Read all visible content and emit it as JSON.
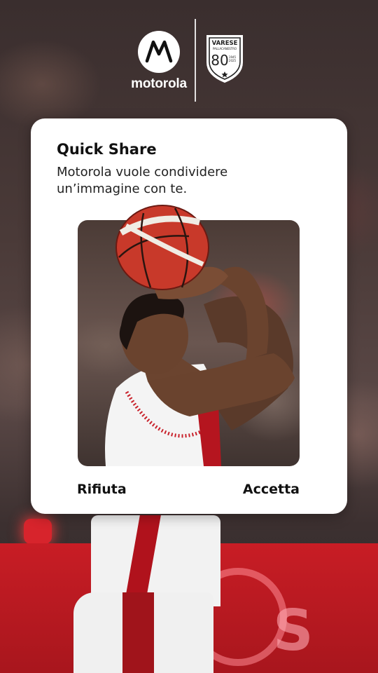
{
  "brand": {
    "motorola_word": "motorola",
    "varese_crest_text": "VARESE",
    "varese_crest_sub": "PALLACANESTRO",
    "varese_crest_number": "80",
    "varese_crest_years_top": "1945",
    "varese_crest_years_bottom": "2025"
  },
  "dialog": {
    "title": "Quick Share",
    "message": "Motorola vuole condividere un’immagine con te.",
    "reject_label": "Rifiuta",
    "accept_label": "Accetta"
  },
  "colors": {
    "card_bg": "#ffffff",
    "banner_red": "#c81d25",
    "text_dark": "#111111"
  },
  "icons": {
    "motorola_logo": "motorola-m-icon",
    "varese_logo": "varese-crest-icon"
  }
}
